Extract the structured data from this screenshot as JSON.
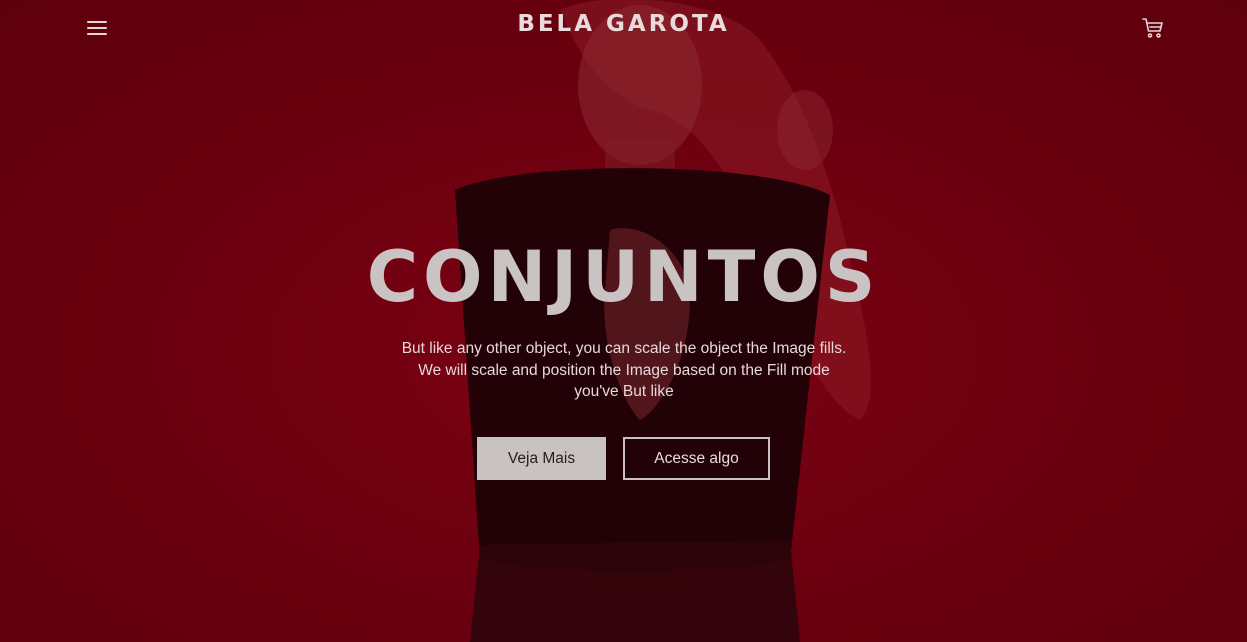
{
  "header": {
    "menu_icon": "hamburger-menu-icon",
    "brand": "BELA GAROTA",
    "cart_icon": "shopping-cart-icon"
  },
  "hero": {
    "title": "CONJUNTOS",
    "description": "But like any other object, you can scale the object the Image fills. We will scale and position the Image based on the Fill mode you've But like",
    "primary_button": "Veja Mais",
    "secondary_button": "Acesse algo",
    "background_image": "woman-with-sunglasses-in-black-tshirt-red-overlay"
  },
  "colors": {
    "overlay": "#6b0010",
    "title": "#c9c3c4",
    "text": "#e6d9db",
    "button_fill": "#c8c2c3"
  }
}
